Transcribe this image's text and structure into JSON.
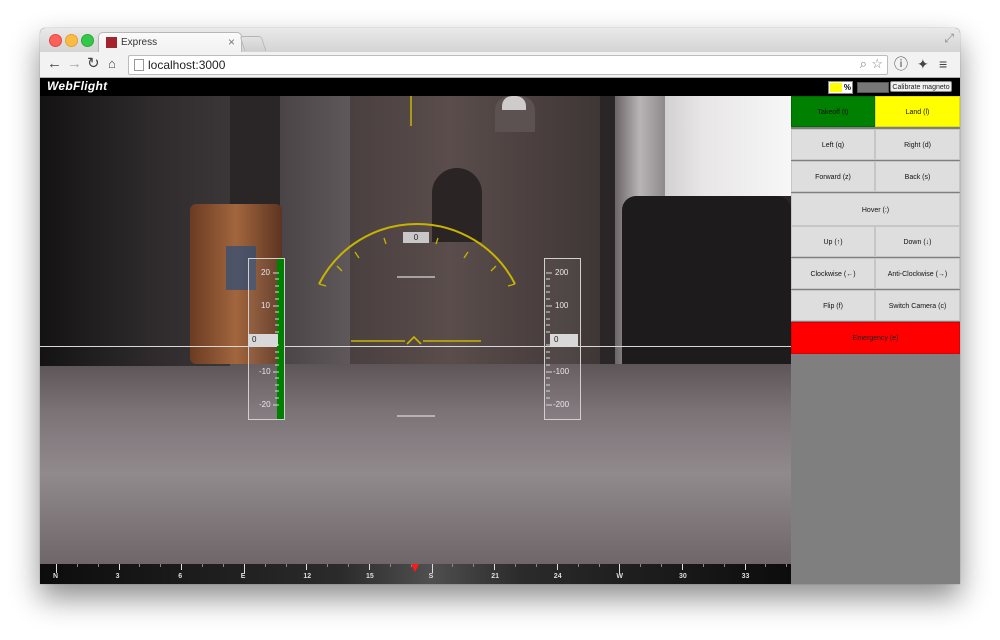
{
  "browser": {
    "tab_title": "Express",
    "url": "localhost:3000"
  },
  "icons": {
    "back": "arrow-left-icon",
    "forward": "arrow-right-icon",
    "reload": "reload-icon",
    "home": "home-icon",
    "zoom": "magnifier-icon",
    "bookmark": "star-icon",
    "info": "info-icon",
    "extension": "puzzle-icon",
    "menu": "hamburger-icon",
    "expand": "expand-icon",
    "tab_close": "close-icon"
  },
  "app": {
    "logo": "WebFlight",
    "battery_label": "%",
    "battery_level": 0.55,
    "calibrate_label": "Calibrate magneto"
  },
  "hud": {
    "heading_value": "0",
    "altitude_value": "0",
    "vertical_speed_value": "0",
    "left_tape_labels": [
      "20",
      "10",
      "-10",
      "-20"
    ],
    "right_tape_labels": [
      "200",
      "100",
      "-100",
      "-200"
    ]
  },
  "compass": {
    "labels": [
      "N",
      "3",
      "6",
      "E",
      "12",
      "15",
      "S",
      "21",
      "24",
      "W",
      "30",
      "33"
    ],
    "pointer_bearing_deg": 175
  },
  "controls": {
    "takeoff": "Takeoff (t)",
    "land": "Land (l)",
    "left": "Left (q)",
    "right": "Right (d)",
    "forward": "Forward (z)",
    "back": "Back (s)",
    "hover": "Hover (:)",
    "up": "Up (↑)",
    "down": "Down (↓)",
    "clockwise": "Clockwise (←)",
    "anticlockwise": "Anti-Clockwise (→)",
    "flip": "Flip (f)",
    "switch_camera": "Switch Camera (c)",
    "emergency": "Emergency (e)"
  },
  "colors": {
    "takeoff": "#008000",
    "land": "#ffff00",
    "emergency": "#ff0000",
    "hud_yellow": "#c8b400",
    "altitude_bar": "#008000",
    "compass_pointer": "#ff1a1a"
  }
}
